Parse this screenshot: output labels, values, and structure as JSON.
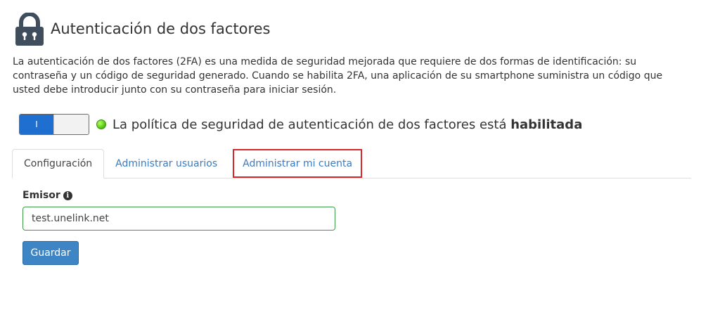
{
  "header": {
    "title": "Autenticación de dos factores",
    "icon": "lock-icon"
  },
  "description": "La autenticación de dos factores (2FA) es una medida de seguridad mejorada que requiere de dos formas de identificación: su contraseña y un código de seguridad generado. Cuando se habilita 2FA, una aplicación de su smartphone suministra un código que usted debe introducir junto con su contraseña para iniciar sesión.",
  "status": {
    "toggle_label": "I",
    "toggle_on": true,
    "text": "La política de seguridad de autenticación de dos factores está ",
    "state": "habilitada",
    "dot_color": "#5fcf16"
  },
  "tabs": [
    {
      "label": "Configuración",
      "active": true
    },
    {
      "label": "Administrar usuarios",
      "active": false
    },
    {
      "label": "Administrar mi cuenta",
      "active": false,
      "highlighted": true
    }
  ],
  "form": {
    "issuer_label": "Emisor",
    "issuer_value": "test.unelink.net",
    "info_icon": "info-icon",
    "save_label": "Guardar"
  },
  "colors": {
    "accent": "#3e85c6",
    "toggle": "#1f6fd1",
    "highlight": "#d9262b",
    "field_border": "#3c9a48"
  }
}
